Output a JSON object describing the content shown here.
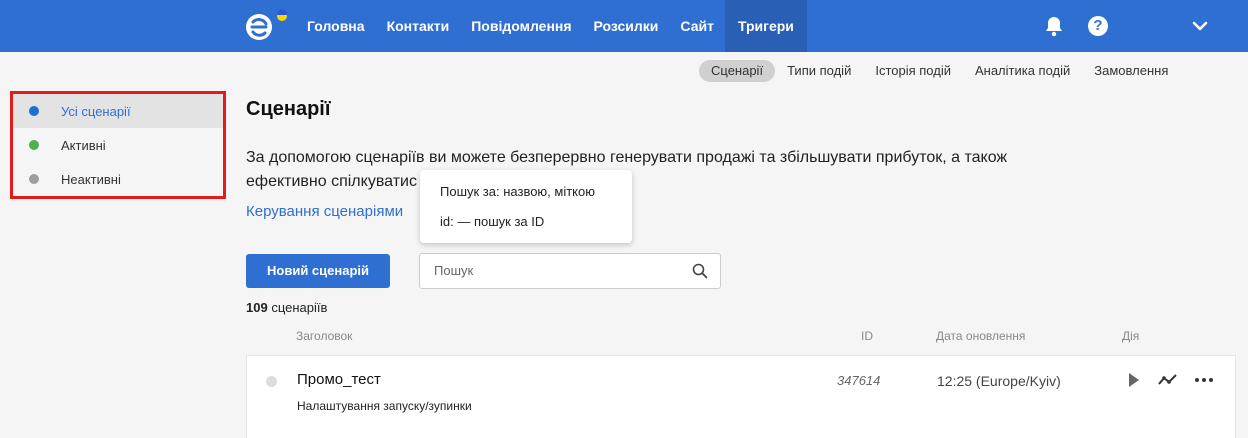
{
  "header": {
    "nav": [
      "Головна",
      "Контакти",
      "Повідомлення",
      "Розсилки",
      "Сайт",
      "Тригери"
    ],
    "active_nav": "Тригери",
    "help_label": "?"
  },
  "subnav": [
    "Сценарії",
    "Типи подій",
    "Історія подій",
    "Аналітика подій",
    "Замовлення"
  ],
  "sidebar": {
    "items": [
      {
        "label": "Усі сценарії",
        "color": "#1f6fd1"
      },
      {
        "label": "Активні",
        "color": "#4caf50"
      },
      {
        "label": "Неактивні",
        "color": "#9e9e9e"
      }
    ]
  },
  "main": {
    "title": "Сценарії",
    "description_line1": "За допомогою сценаріїв ви можете безперервно генерувати продажі та збільшувати прибуток, а також",
    "description_line2": "ефективно спілкуватис",
    "manage_link": "Керування сценаріями",
    "tooltip": {
      "line1": "Пошук за: назвою, міткою",
      "line2": "id: — пошук за ID"
    },
    "new_button": "Новий сценарій",
    "search_placeholder": "Пошук",
    "count_number": "109",
    "count_label": "сценаріїв"
  },
  "table": {
    "headers": {
      "title": "Заголовок",
      "id": "ID",
      "date": "Дата оновлення",
      "action": "Дія"
    },
    "rows": [
      {
        "title": "Промо_тест",
        "subtitle": "Налаштування запуску/зупинки",
        "id": "347614",
        "date": "12:25 (Europe/Kyiv)"
      }
    ]
  }
}
